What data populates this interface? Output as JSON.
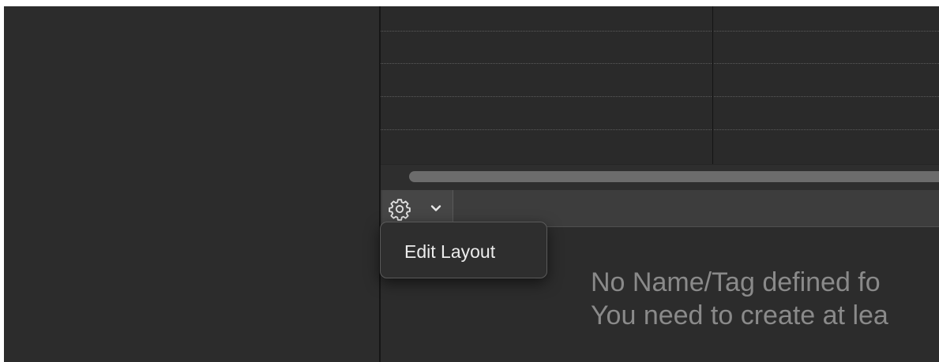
{
  "toolbar": {
    "settings_icon": "gear-icon",
    "dropdown_icon": "chevron-down-icon"
  },
  "menu": {
    "items": [
      {
        "label": "Edit Layout"
      }
    ]
  },
  "empty_state": {
    "line1": "No Name/Tag defined fo",
    "line2": "You need to create at lea"
  },
  "colors": {
    "background": "#2b2b2b",
    "toolbar": "#3d3d3d",
    "menu_text": "#ececec",
    "message_text": "#8a8a8a"
  }
}
